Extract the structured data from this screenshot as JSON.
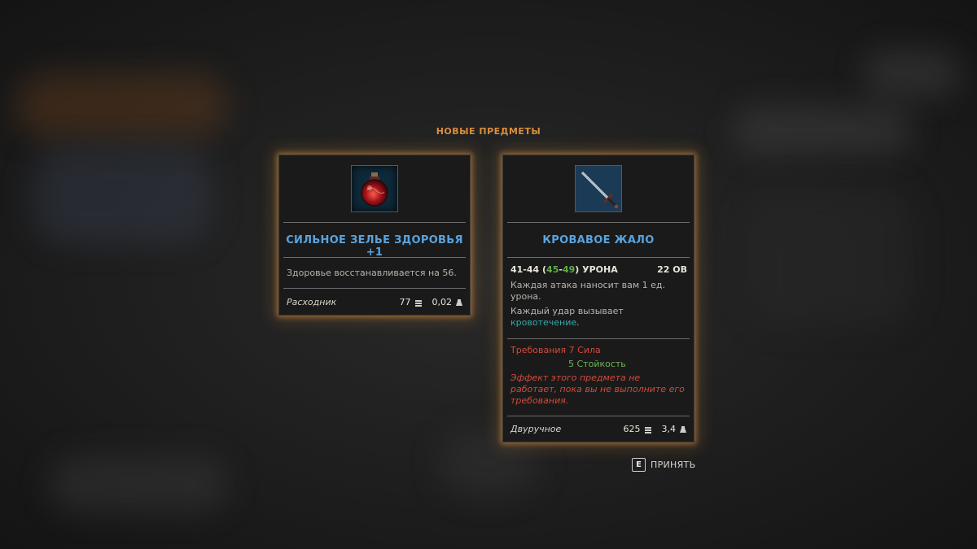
{
  "header": {
    "title": "НОВЫЕ ПРЕДМЕТЫ"
  },
  "items": [
    {
      "icon": "health-potion-icon",
      "name": "СИЛЬНОЕ ЗЕЛЬЕ ЗДОРОВЬЯ +1",
      "description": "Здоровье восстанавливается на 56.",
      "type": "Расходник",
      "value": "77",
      "weight": "0,02"
    },
    {
      "icon": "sword-icon",
      "name": "КРОВАВОЕ ЖАЛО",
      "damage_base": "41-44",
      "damage_bonus_low": "45",
      "damage_bonus_high": "49",
      "damage_label": "УРОНА",
      "ap_cost": "22 ОВ",
      "effect1": "Каждая атака наносит вам 1 ед. урона.",
      "effect2_prefix": "Каждый удар вызывает",
      "effect2_link": "кровотечение",
      "effect2_suffix": ".",
      "req_line1": "Требования 7 Сила",
      "req_line2": "5 Стойкость",
      "warning": "Эффект этого предмета не работает, пока вы не выполните его требования.",
      "type": "Двуручное",
      "value": "625",
      "weight": "3,4"
    }
  ],
  "accept": {
    "key": "E",
    "label": "ПРИНЯТЬ"
  },
  "colors": {
    "accent": "#d98e3c",
    "item_name": "#5aa3dd",
    "bonus_green": "#5fae4a",
    "link_teal": "#3aa6a6",
    "requirement_red": "#d24a3a",
    "met_green": "#6fb25a"
  }
}
